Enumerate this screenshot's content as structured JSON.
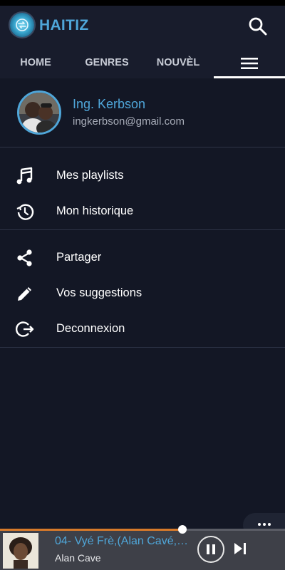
{
  "app": {
    "title": "HAITIZ"
  },
  "tabs": [
    {
      "label": "HOME"
    },
    {
      "label": "GENRES"
    },
    {
      "label": "NOUVÈL"
    },
    {
      "icon": "menu-icon"
    }
  ],
  "active_tab": 3,
  "profile": {
    "name": "Ing. Kerbson",
    "email": "ingkerbson@gmail.com"
  },
  "menu": {
    "section1": [
      {
        "label": "Mes playlists",
        "icon": "music-note-icon"
      },
      {
        "label": "Mon historique",
        "icon": "history-icon"
      }
    ],
    "section2": [
      {
        "label": "Partager",
        "icon": "share-icon"
      },
      {
        "label": "Vos suggestions",
        "icon": "pencil-icon"
      },
      {
        "label": "Deconnexion",
        "icon": "logout-icon"
      }
    ]
  },
  "player": {
    "title": "04- Vyé Frè,(Alan Cavé,(…",
    "artist": "Alan Cave",
    "progress": 0.64
  },
  "colors": {
    "accent": "#4fa6d9",
    "background": "#131725",
    "appbar": "#181c2c",
    "progress": "#d77a2a"
  }
}
